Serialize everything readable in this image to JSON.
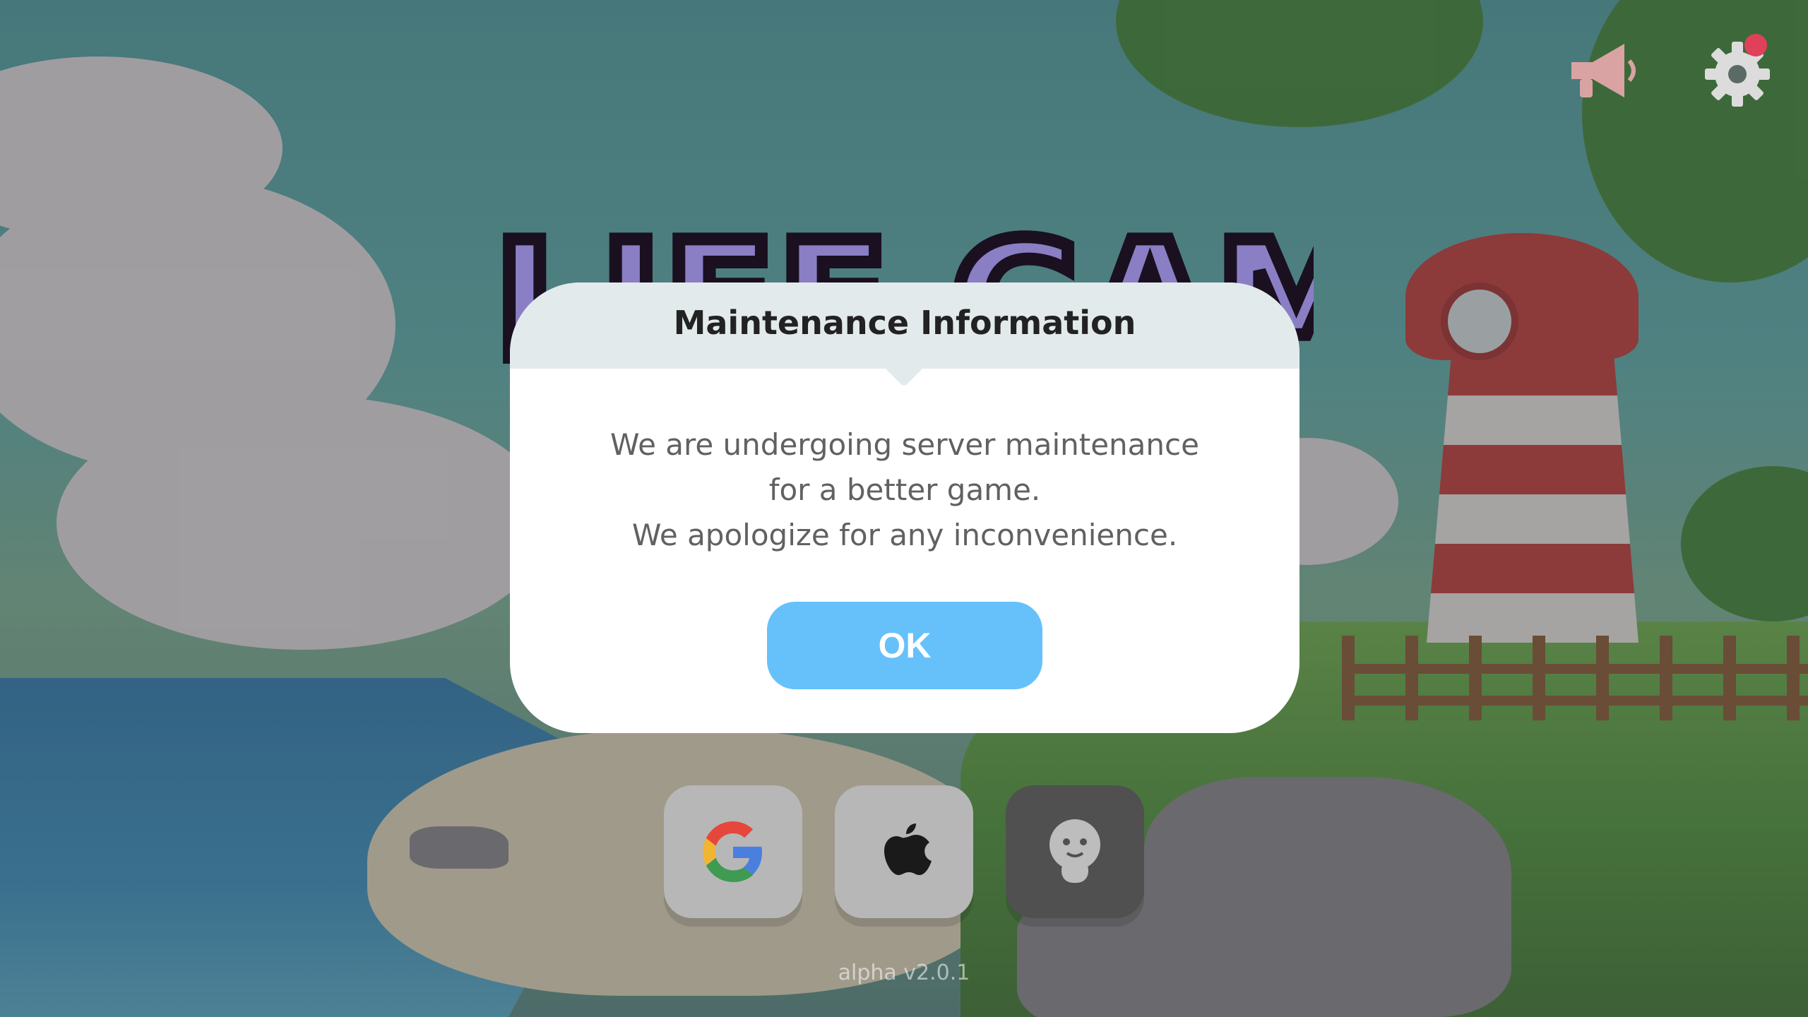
{
  "game": {
    "logo_text": "LIFE GAME",
    "version": "alpha v2.0.1"
  },
  "top_bar": {
    "icons": [
      "megaphone-icon",
      "gear-icon"
    ],
    "notification_dot_color": "#e0405a"
  },
  "login": {
    "buttons": [
      {
        "icon": "google-icon",
        "color": "#b7b7b7"
      },
      {
        "icon": "apple-icon",
        "color": "#b7b7b7"
      },
      {
        "icon": "guest-icon",
        "color": "#505050"
      }
    ]
  },
  "modal": {
    "title": "Maintenance Information",
    "message_lines": [
      "We are undergoing server maintenance",
      "for a better game.",
      "We apologize for any inconvenience."
    ],
    "ok_label": "OK",
    "accent_color": "#66c1fb",
    "header_color": "#e3eaec"
  }
}
